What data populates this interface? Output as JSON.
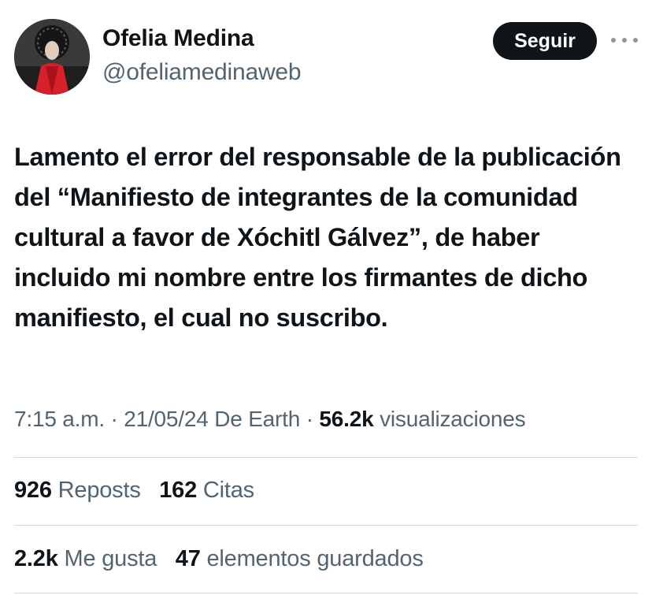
{
  "profile": {
    "name": "Ofelia Medina",
    "handle": "@ofeliamedinaweb",
    "follow_label": "Seguir"
  },
  "tweet": {
    "text": "Lamento el error del responsable de la publicación del “Manifiesto de integrantes de la comunidad cultural a favor de Xóchitl Gálvez”, de haber incluido mi nombre entre los firmantes de dicho manifiesto, el cual no suscribo."
  },
  "meta": {
    "time": "7:15 a.m.",
    "separator1": " · ",
    "date": "21/05/24",
    "source": " De Earth",
    "separator2": " · ",
    "views_count": "56.2k",
    "views_label": " visualizaciones"
  },
  "stats_row1": {
    "reposts_count": "926",
    "reposts_label": "Reposts",
    "quotes_count": "162",
    "quotes_label": "Citas"
  },
  "stats_row2": {
    "likes_count": "2.2k",
    "likes_label": "Me gusta",
    "bookmarks_count": "47",
    "bookmarks_label": "elementos guardados"
  },
  "colors": {
    "primary_text": "#0f1419",
    "secondary_text": "#536471",
    "divider": "#cfd9de",
    "follow_bg": "#0f1419"
  },
  "icons": {
    "more": "more-options-icon"
  }
}
